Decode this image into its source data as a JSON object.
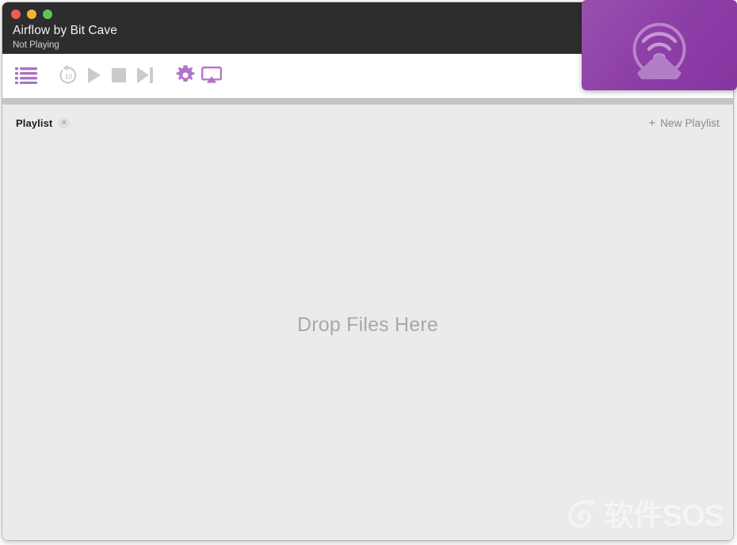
{
  "window": {
    "title": "Airflow by Bit Cave",
    "status": "Not Playing",
    "traffic_lights": [
      {
        "name": "close",
        "color": "#f05b54"
      },
      {
        "name": "minimize",
        "color": "#f2b43c"
      },
      {
        "name": "maximize",
        "color": "#63c45d"
      }
    ]
  },
  "toolbar": {
    "buttons": [
      {
        "icon": "playlist-list-icon",
        "label": "Playlist",
        "color": "#a874c0",
        "enabled": true
      },
      {
        "icon": "skip-back-10-icon",
        "label": "Back 10 Seconds",
        "color": "#c9c9c9",
        "enabled": false
      },
      {
        "icon": "play-icon",
        "label": "Play",
        "color": "#c9c9c9",
        "enabled": false
      },
      {
        "icon": "stop-icon",
        "label": "Stop",
        "color": "#c9c9c9",
        "enabled": false
      },
      {
        "icon": "next-track-icon",
        "label": "Next",
        "color": "#c9c9c9",
        "enabled": false
      },
      {
        "icon": "gear-icon",
        "label": "Settings",
        "color": "#b273c9",
        "enabled": true
      },
      {
        "icon": "airplay-icon",
        "label": "AirPlay",
        "color": "#b273c9",
        "enabled": true
      }
    ],
    "skip_back_seconds": "10"
  },
  "playlist_bar": {
    "tab_label": "Playlist",
    "close_glyph": "×",
    "new_playlist_plus": "+",
    "new_playlist_label": "New Playlist"
  },
  "drop_area": {
    "message": "Drop Files Here"
  },
  "airplay_panel": {
    "icon": "airplay-wifi-logo",
    "accent_color": "#8d3fa8"
  },
  "watermark": {
    "text": "软件SOS"
  }
}
